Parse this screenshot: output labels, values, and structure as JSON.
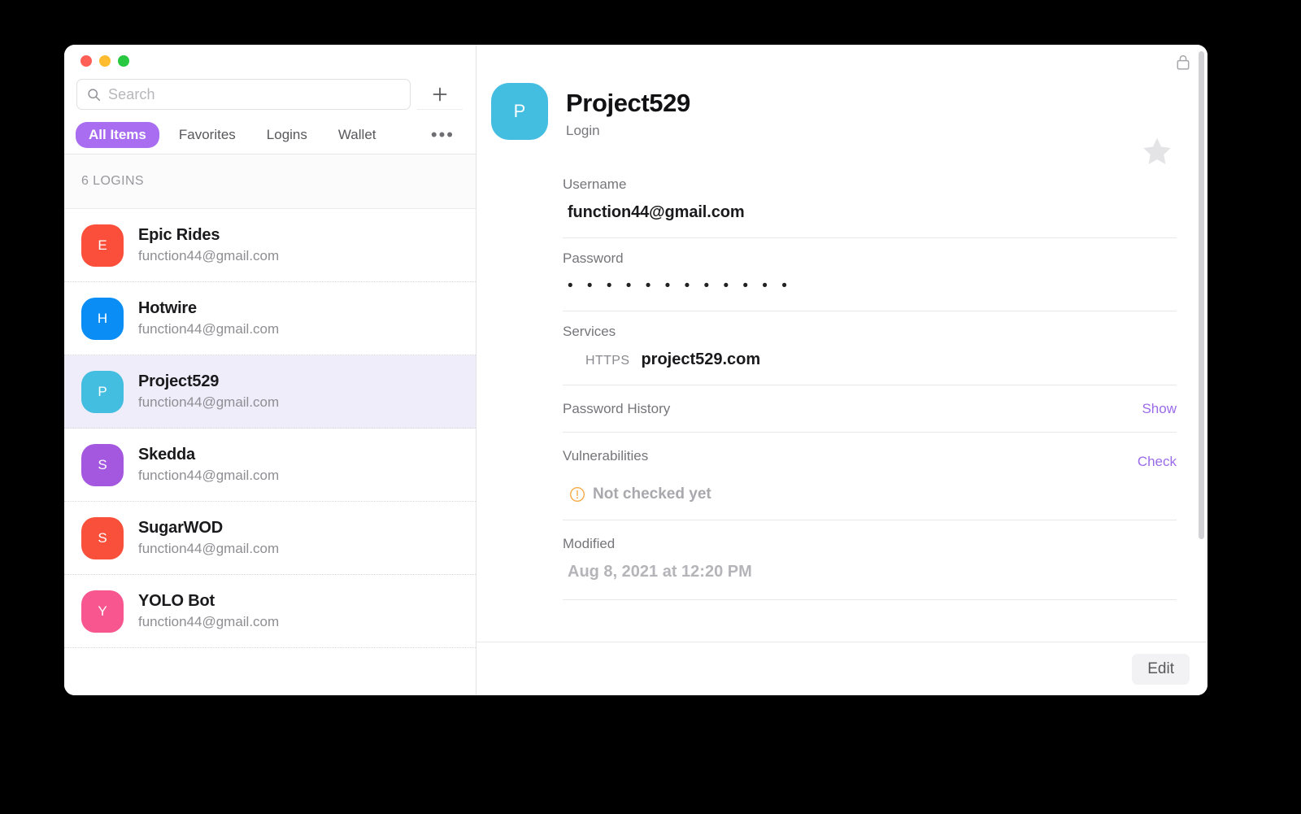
{
  "window": {
    "traffic_lights": [
      {
        "name": "close",
        "color": "#ff5f57"
      },
      {
        "name": "minimize",
        "color": "#febc2e"
      },
      {
        "name": "zoom",
        "color": "#28c840"
      }
    ]
  },
  "sidebar": {
    "search": {
      "placeholder": "Search",
      "value": "",
      "icon": "search-icon"
    },
    "add_button_icon": "plus-icon",
    "tabs": [
      {
        "label": "All Items",
        "active": true
      },
      {
        "label": "Favorites",
        "active": false
      },
      {
        "label": "Logins",
        "active": false
      },
      {
        "label": "Wallet",
        "active": false
      }
    ],
    "more_tabs_label": "•••",
    "group_header": "6 LOGINS",
    "items": [
      {
        "initial": "E",
        "title": "Epic Rides",
        "subtitle": "function44@gmail.com",
        "color": "#fb4f3b",
        "selected": false
      },
      {
        "initial": "H",
        "title": "Hotwire",
        "subtitle": "function44@gmail.com",
        "color": "#0a8ef5",
        "selected": false
      },
      {
        "initial": "P",
        "title": "Project529",
        "subtitle": "function44@gmail.com",
        "color": "#43bde0",
        "selected": true
      },
      {
        "initial": "S",
        "title": "Skedda",
        "subtitle": "function44@gmail.com",
        "color": "#a458e0",
        "selected": false
      },
      {
        "initial": "S",
        "title": "SugarWOD",
        "subtitle": "function44@gmail.com",
        "color": "#f9503c",
        "selected": false
      },
      {
        "initial": "Y",
        "title": "YOLO Bot",
        "subtitle": "function44@gmail.com",
        "color": "#f7568f",
        "selected": false
      }
    ]
  },
  "detail": {
    "lock_icon": "lock-closed-icon",
    "favorite_icon": "star-icon",
    "avatar": {
      "initial": "P",
      "color": "#43bde0"
    },
    "title": "Project529",
    "subtitle": "Login",
    "username": {
      "label": "Username",
      "value": "function44@gmail.com"
    },
    "password": {
      "label": "Password",
      "masked": "• • • • • • • • • • • •"
    },
    "services": {
      "label": "Services",
      "entries": [
        {
          "scheme": "HTTPS",
          "host": "project529.com"
        }
      ]
    },
    "password_history": {
      "label": "Password History",
      "action": "Show"
    },
    "vulnerabilities": {
      "label": "Vulnerabilities",
      "action": "Check",
      "status_text": "Not checked yet",
      "status_icon": "warning-circle-icon",
      "status_color": "#f5a623"
    },
    "modified": {
      "label": "Modified",
      "value": "Aug 8, 2021 at 12:20 PM"
    },
    "footer": {
      "edit_label": "Edit"
    }
  },
  "colors": {
    "accent": "#a86df0",
    "link": "#9b6bea",
    "selected_row": "#f0edfb"
  }
}
